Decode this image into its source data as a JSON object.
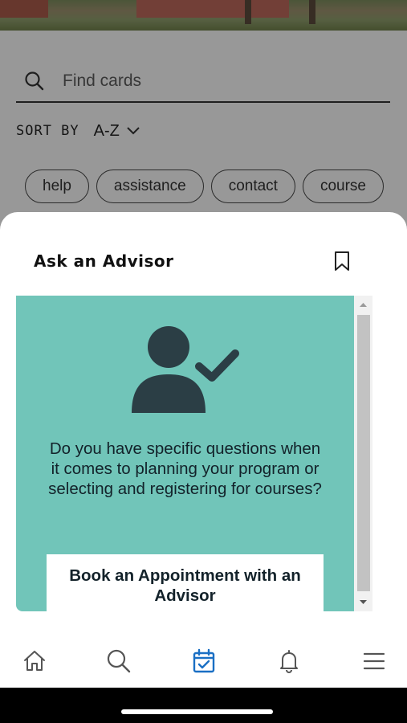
{
  "search": {
    "placeholder": "Find cards",
    "value": ""
  },
  "sort": {
    "label": "SORT BY",
    "value": "A-Z"
  },
  "chips": [
    "help",
    "assistance",
    "contact",
    "course"
  ],
  "sheet": {
    "title": "Ask an Advisor",
    "card": {
      "text": "Do you have specific questions when it comes to planning your program or selecting and registering for courses?",
      "button_label": "Book an Appointment with an Advisor",
      "accent_color": "#71c5b9"
    }
  },
  "nav": {
    "items": [
      "home-icon",
      "search-icon",
      "calendar-check-icon",
      "bell-icon",
      "menu-icon"
    ],
    "active": "calendar-check-icon",
    "active_color": "#1a6fc4"
  }
}
